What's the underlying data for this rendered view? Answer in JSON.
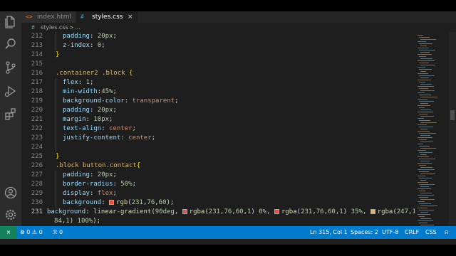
{
  "tabs": [
    {
      "icon": "<>",
      "label": "index.html",
      "active": false
    },
    {
      "icon": "#",
      "label": "styles.css",
      "active": true,
      "close": "×"
    }
  ],
  "breadcrumb": {
    "icon": "#",
    "file": "styles.css",
    "separator": ">",
    "rest": "..."
  },
  "activity_icons": [
    "files-icon",
    "search-icon",
    "source-control-icon",
    "run-debug-icon",
    "extensions-icon",
    "account-icon",
    "settings-gear-icon"
  ],
  "code": [
    {
      "num": "212",
      "html": "<span class='p'>padding</span>: <span class='n'>20px</span>;"
    },
    {
      "num": "213",
      "html": "<span class='p'>z-index</span>: <span class='n'>0</span>;"
    },
    {
      "num": "214",
      "html": "<span class='b'>}</span>"
    },
    {
      "num": "215",
      "html": ""
    },
    {
      "num": "216",
      "html": "<span class='s'>.container2 .block</span> <span class='b'>{</span>"
    },
    {
      "num": "217",
      "html": "<span class='p'>flex</span>: <span class='n'>1</span>;"
    },
    {
      "num": "218",
      "html": "<span class='p'>min-width</span>:<span class='n'>45%</span>;"
    },
    {
      "num": "219",
      "html": "<span class='p'>background-color</span>: <span class='v'>transparent</span>;"
    },
    {
      "num": "220",
      "html": "<span class='p'>padding</span>: <span class='n'>20px</span>;"
    },
    {
      "num": "221",
      "html": "<span class='p'>margin</span>: <span class='n'>10px</span>;"
    },
    {
      "num": "222",
      "html": "<span class='p'>text-align</span>: <span class='v'>center</span>;"
    },
    {
      "num": "223",
      "html": "<span class='p'>justify-content</span>: <span class='v'>center</span>;"
    },
    {
      "num": "224",
      "html": ""
    },
    {
      "num": "225",
      "html": "<span class='b'>}</span>"
    },
    {
      "num": "226",
      "html": "<span class='s'>.block button.contact</span><span class='b'>{</span>"
    },
    {
      "num": "227",
      "html": "<span class='p'>padding</span>: <span class='n'>20px</span>;"
    },
    {
      "num": "228",
      "html": "<span class='p'>border-radius</span>: <span class='n'>50%</span>;"
    },
    {
      "num": "229",
      "html": "<span class='p'>display</span>: <span class='v'>flex</span>;"
    },
    {
      "num": "230",
      "html": "<span class='p'>background</span>: <span class='sw' style='background:#e74c3c'></span><span class='f'>rgb</span>(<span class='n'>231</span>,<span class='n'>76</span>,<span class='n'>60</span>);"
    },
    {
      "num": "231",
      "html": "<span class='p'>background</span>: <span class='f'>linear-gradient</span>(<span class='n'>90deg</span>, <span class='sw' style='background:#e74c3c'></span><span class='f'>rgba</span>(<span class='n'>231</span>,<span class='n'>76</span>,<span class='n'>60</span>,<span class='n'>1</span>) <span class='n'>0%</span>, <span class='sw' style='background:#e74c3c'></span><span class='f'>rgba</span>(<span class='n'>231</span>,<span class='n'>76</span>,<span class='n'>60</span>,<span class='n'>1</span>) <span class='n'>35%</span>, <span class='sw' style='background:#f7b24e'></span><span class='f'>rgba</span>(<span class='n'>247</span>,<span class='n'>1</span>"
    },
    {
      "num": "",
      "html": "<span class='n'>84</span>,<span class='n'>1</span>) <span class='n'>100%</span>);"
    }
  ],
  "status": {
    "remote": "⨯",
    "errors": "0",
    "warnings": "0",
    "ports": "0",
    "position": "Ln 315, Col 1",
    "spaces": "Spaces: 2",
    "encoding": "UTF-8",
    "eol": "CRLF",
    "language": "CSS"
  },
  "colors": {
    "accent": "#007acc",
    "editor_bg": "#1e1e1e",
    "swatch_red": "#e74c3c",
    "swatch_orange": "#f7b24e"
  }
}
